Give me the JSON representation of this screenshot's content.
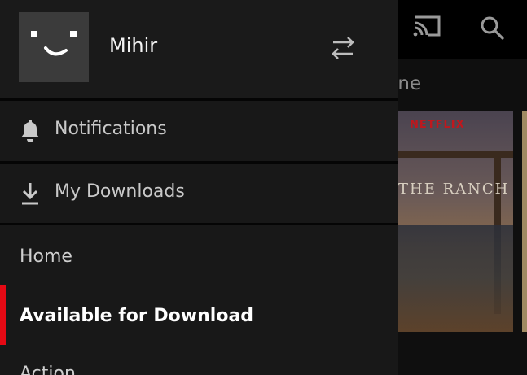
{
  "background": {
    "section_title": "ine",
    "poster": {
      "brand": "NETFLIX",
      "title": "THE RANCH"
    },
    "icons": [
      "cast-icon",
      "search-icon"
    ]
  },
  "drawer": {
    "profile": {
      "name": "Mihir",
      "avatar": "smiley-avatar",
      "switch_icon": "switch-profile-icon"
    },
    "menu": [
      {
        "label": "Notifications",
        "icon": "bell-icon"
      },
      {
        "label": "My Downloads",
        "icon": "download-icon"
      }
    ],
    "nav": [
      {
        "label": "Home",
        "active": false
      },
      {
        "label": "Available for Download",
        "active": true
      },
      {
        "label": "Action",
        "active": false
      }
    ]
  },
  "colors": {
    "accent": "#e50914",
    "drawer_bg": "#181818",
    "text": "#cfcfcf"
  }
}
